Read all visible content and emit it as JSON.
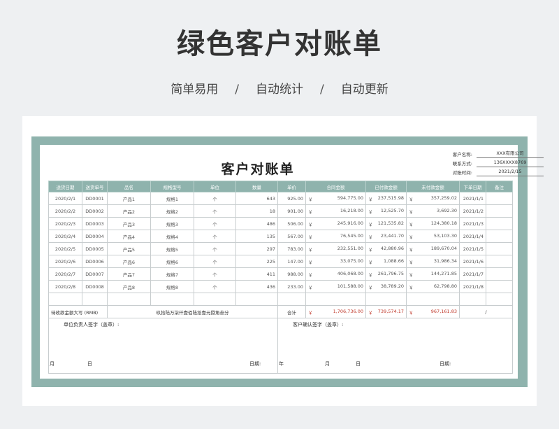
{
  "page": {
    "title": "绿色客户对账单",
    "subtitle": [
      "简单易用",
      "自动统计",
      "自动更新"
    ],
    "separator": "/"
  },
  "doc": {
    "title": "客户对账单",
    "info": [
      {
        "label": "客户名称:",
        "value": "XXX有限公司"
      },
      {
        "label": "联系方式:",
        "value": "136XXXX8769"
      },
      {
        "label": "对账时间:",
        "value": "2021/2/15"
      }
    ],
    "columns": [
      "送货日期",
      "送货单号",
      "品名",
      "规格型号",
      "单位",
      "数量",
      "单价",
      "合同金额",
      "已付款金额",
      "未付款金额",
      "下单日期",
      "备注"
    ],
    "currency": "￥",
    "rows": [
      {
        "date": "2020/2/1",
        "no": "DD0001",
        "name": "产品1",
        "spec": "规格1",
        "unit": "个",
        "qty": "643",
        "price": "925.00",
        "contract": "594,775.00",
        "paid": "237,515.98",
        "unpaid": "357,259.02",
        "order": "2021/1/1"
      },
      {
        "date": "2020/2/2",
        "no": "DD0002",
        "name": "产品2",
        "spec": "规格2",
        "unit": "个",
        "qty": "18",
        "price": "901.00",
        "contract": "16,218.00",
        "paid": "12,525.70",
        "unpaid": "3,692.30",
        "order": "2021/1/2"
      },
      {
        "date": "2020/2/3",
        "no": "DD0003",
        "name": "产品3",
        "spec": "规格3",
        "unit": "个",
        "qty": "486",
        "price": "506.00",
        "contract": "245,916.00",
        "paid": "121,535.82",
        "unpaid": "124,380.18",
        "order": "2021/1/3"
      },
      {
        "date": "2020/2/4",
        "no": "DD0004",
        "name": "产品4",
        "spec": "规格4",
        "unit": "个",
        "qty": "135",
        "price": "567.00",
        "contract": "76,545.00",
        "paid": "23,441.70",
        "unpaid": "53,103.30",
        "order": "2021/1/4"
      },
      {
        "date": "2020/2/5",
        "no": "DD0005",
        "name": "产品5",
        "spec": "规格5",
        "unit": "个",
        "qty": "297",
        "price": "783.00",
        "contract": "232,551.00",
        "paid": "42,880.96",
        "unpaid": "189,670.04",
        "order": "2021/1/5"
      },
      {
        "date": "2020/2/6",
        "no": "DD0006",
        "name": "产品6",
        "spec": "规格6",
        "unit": "个",
        "qty": "225",
        "price": "147.00",
        "contract": "33,075.00",
        "paid": "1,088.66",
        "unpaid": "31,986.34",
        "order": "2021/1/6"
      },
      {
        "date": "2020/2/7",
        "no": "DD0007",
        "name": "产品7",
        "spec": "规格7",
        "unit": "个",
        "qty": "411",
        "price": "988.00",
        "contract": "406,068.00",
        "paid": "261,796.75",
        "unpaid": "144,271.85",
        "order": "2021/1/7"
      },
      {
        "date": "2020/2/8",
        "no": "DD0008",
        "name": "产品8",
        "spec": "规格8",
        "unit": "个",
        "qty": "436",
        "price": "233.00",
        "contract": "101,588.00",
        "paid": "38,789.20",
        "unpaid": "62,798.80",
        "order": "2021/1/8"
      }
    ],
    "total": {
      "label": "待收款金额大写 (RMB)",
      "amount_words": "玖拾陆万柒仟壹佰陆拾壹元捌角叁分",
      "sum_label": "合计",
      "contract": "1,706,736.00",
      "paid": "739,574.17",
      "unpaid": "967,161.83",
      "slash": "/"
    },
    "sign": {
      "left_label": "单位负责人签字（盖章）:",
      "right_label": "客户确认签字（盖章）:",
      "date_label": "日期:",
      "year": "年",
      "month": "月",
      "day": "日"
    }
  }
}
